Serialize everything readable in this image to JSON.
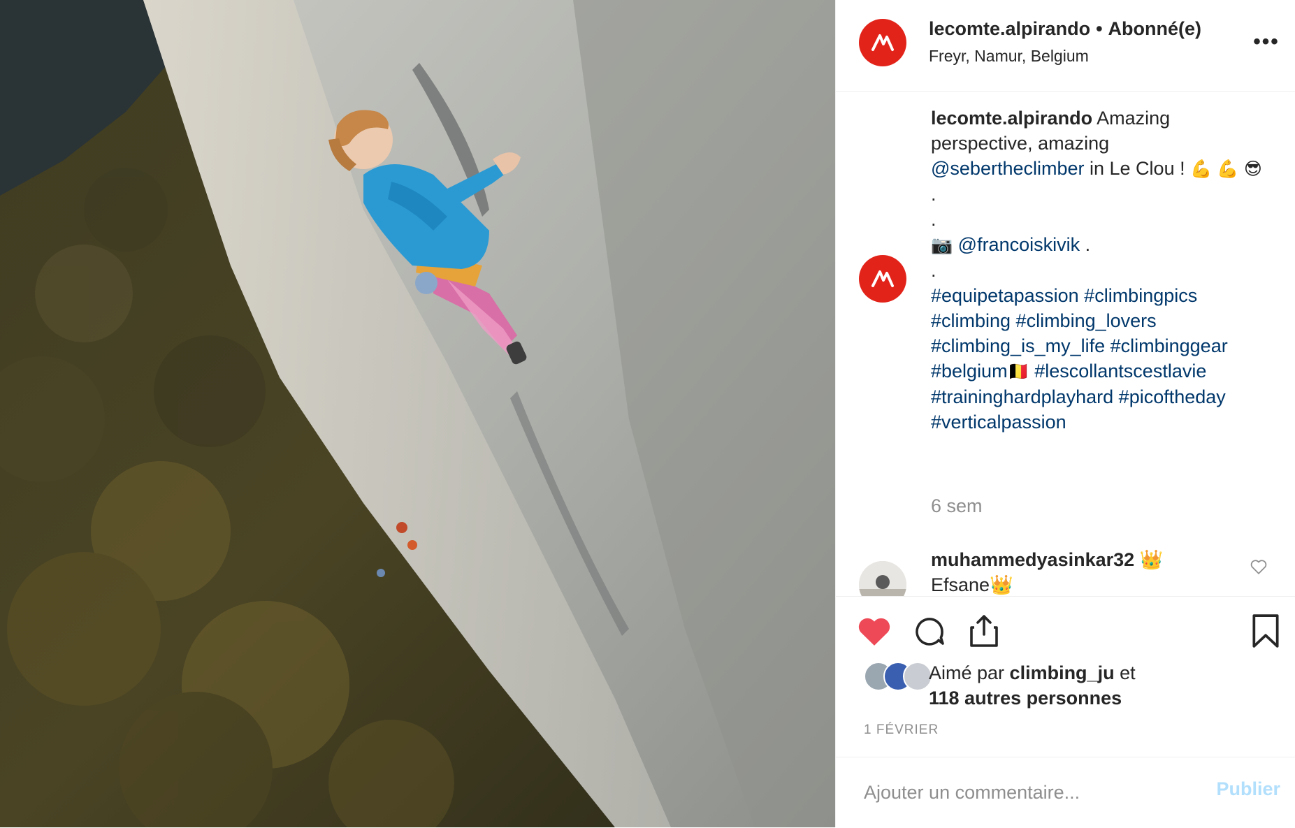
{
  "post": {
    "username": "lecomte.alpirando",
    "dot": "•",
    "follow_status": "Abonné(e)",
    "location": "Freyr, Namur, Belgium",
    "more_label": "•••"
  },
  "caption": {
    "username": "lecomte.alpirando",
    "text_1": " Amazing perspective, amazing ",
    "mention_1": "@sebertheclimber",
    "text_2": " in Le Clou ! ",
    "emoji_1": "💪 💪",
    "emoji_2": "😎",
    "dot_1": ".",
    "dot_2": ".",
    "camera": "📷",
    "mention_2": "@francoiskivik",
    "dot_3": " .",
    "dot_4": ".",
    "hashtags_line_1": "#equipetapassion #climbingpics",
    "hashtags_line_2": "#climbing #climbing_lovers",
    "hashtags_line_3": "#climbing_is_my_life #climbinggear",
    "hashtags_line_4a": "#belgium",
    "flag": "🇧🇪",
    "hashtags_line_4b": "  #lescollantscestlavie",
    "hashtags_line_5": "#traininghardplayhard #picoftheday",
    "hashtags_line_6": "#verticalpassion",
    "time_ago": "6 sem"
  },
  "comment": {
    "username": "muhammedyasinkar32",
    "username_emoji": "👑",
    "text": "Efsane👑"
  },
  "likes": {
    "prefix": "Aimé par ",
    "first_user": "climbing_ju",
    "suffix": " et",
    "others": "118 autres personnes"
  },
  "date": "1 FÉVRIER",
  "add_comment": {
    "placeholder": "Ajouter un commentaire...",
    "publish_label": "Publier"
  },
  "colors": {
    "brand_red": "#e2231a",
    "like_red": "#ed4956",
    "link_blue": "#00376b",
    "publish_disabled": "#b2dffc"
  }
}
